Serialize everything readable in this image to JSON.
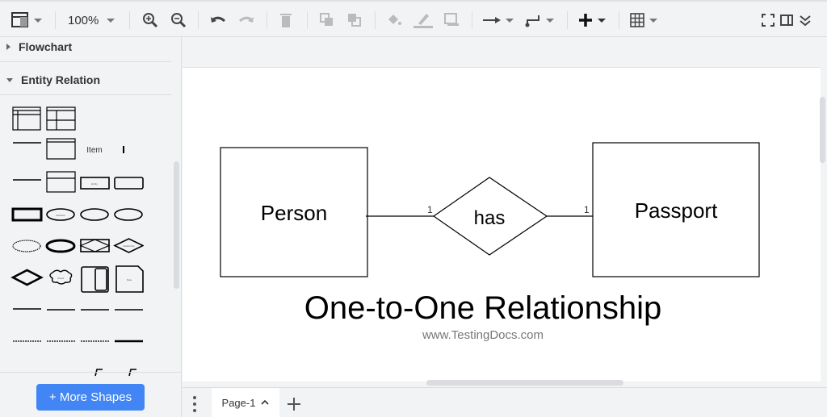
{
  "toolbar": {
    "zoom": "100%",
    "icons": [
      "format-panel-icon",
      "zoom-in-icon",
      "zoom-out-icon",
      "undo-icon",
      "redo-icon",
      "delete-icon",
      "to-front-icon",
      "to-back-icon",
      "fill-color-icon",
      "line-color-icon",
      "shadow-icon",
      "connection-icon",
      "waypoints-icon",
      "insert-icon",
      "table-icon",
      "fullscreen-icon",
      "toggle-panel-icon",
      "collapse-icon"
    ]
  },
  "sidebar": {
    "sections": [
      {
        "label": "Flowchart",
        "expanded": false
      },
      {
        "label": "Entity Relation",
        "expanded": true
      }
    ],
    "palette_labels": {
      "item": "Item",
      "entity": "Entity",
      "attribute": "Attribute",
      "relationship": "Relationship",
      "cloud": "Cloud",
      "note": "Note"
    },
    "more_shapes": "+ More Shapes"
  },
  "diagram": {
    "entity1": "Person",
    "entity2": "Passport",
    "relationship": "has",
    "card1": "1",
    "card2": "1",
    "title": "One-to-One Relationship",
    "subtitle": "www.TestingDocs.com"
  },
  "footer": {
    "page_tab": "Page-1"
  },
  "colors": {
    "accent": "#4285f4",
    "subtitle": "#777777"
  }
}
